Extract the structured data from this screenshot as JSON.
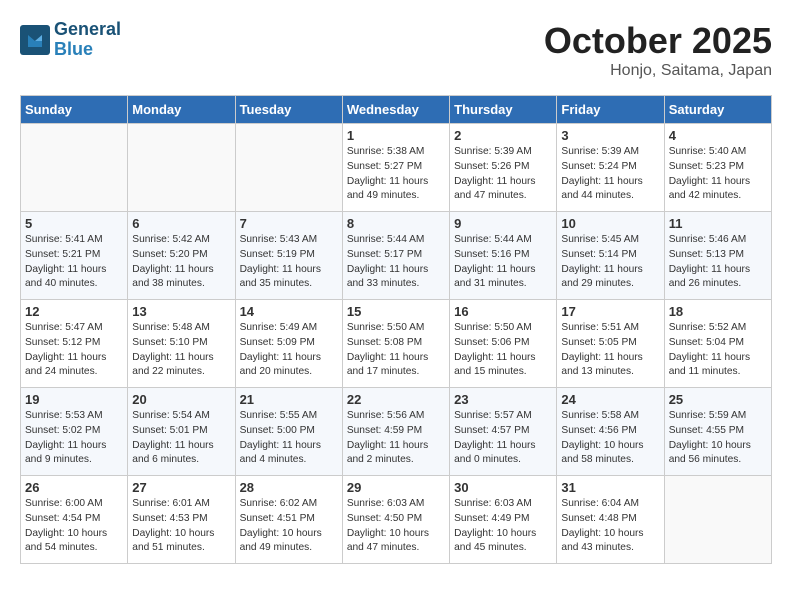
{
  "header": {
    "logo_line1": "General",
    "logo_line2": "Blue",
    "month": "October 2025",
    "location": "Honjo, Saitama, Japan"
  },
  "weekdays": [
    "Sunday",
    "Monday",
    "Tuesday",
    "Wednesday",
    "Thursday",
    "Friday",
    "Saturday"
  ],
  "weeks": [
    [
      {
        "day": "",
        "info": ""
      },
      {
        "day": "",
        "info": ""
      },
      {
        "day": "",
        "info": ""
      },
      {
        "day": "1",
        "info": "Sunrise: 5:38 AM\nSunset: 5:27 PM\nDaylight: 11 hours\nand 49 minutes."
      },
      {
        "day": "2",
        "info": "Sunrise: 5:39 AM\nSunset: 5:26 PM\nDaylight: 11 hours\nand 47 minutes."
      },
      {
        "day": "3",
        "info": "Sunrise: 5:39 AM\nSunset: 5:24 PM\nDaylight: 11 hours\nand 44 minutes."
      },
      {
        "day": "4",
        "info": "Sunrise: 5:40 AM\nSunset: 5:23 PM\nDaylight: 11 hours\nand 42 minutes."
      }
    ],
    [
      {
        "day": "5",
        "info": "Sunrise: 5:41 AM\nSunset: 5:21 PM\nDaylight: 11 hours\nand 40 minutes."
      },
      {
        "day": "6",
        "info": "Sunrise: 5:42 AM\nSunset: 5:20 PM\nDaylight: 11 hours\nand 38 minutes."
      },
      {
        "day": "7",
        "info": "Sunrise: 5:43 AM\nSunset: 5:19 PM\nDaylight: 11 hours\nand 35 minutes."
      },
      {
        "day": "8",
        "info": "Sunrise: 5:44 AM\nSunset: 5:17 PM\nDaylight: 11 hours\nand 33 minutes."
      },
      {
        "day": "9",
        "info": "Sunrise: 5:44 AM\nSunset: 5:16 PM\nDaylight: 11 hours\nand 31 minutes."
      },
      {
        "day": "10",
        "info": "Sunrise: 5:45 AM\nSunset: 5:14 PM\nDaylight: 11 hours\nand 29 minutes."
      },
      {
        "day": "11",
        "info": "Sunrise: 5:46 AM\nSunset: 5:13 PM\nDaylight: 11 hours\nand 26 minutes."
      }
    ],
    [
      {
        "day": "12",
        "info": "Sunrise: 5:47 AM\nSunset: 5:12 PM\nDaylight: 11 hours\nand 24 minutes."
      },
      {
        "day": "13",
        "info": "Sunrise: 5:48 AM\nSunset: 5:10 PM\nDaylight: 11 hours\nand 22 minutes."
      },
      {
        "day": "14",
        "info": "Sunrise: 5:49 AM\nSunset: 5:09 PM\nDaylight: 11 hours\nand 20 minutes."
      },
      {
        "day": "15",
        "info": "Sunrise: 5:50 AM\nSunset: 5:08 PM\nDaylight: 11 hours\nand 17 minutes."
      },
      {
        "day": "16",
        "info": "Sunrise: 5:50 AM\nSunset: 5:06 PM\nDaylight: 11 hours\nand 15 minutes."
      },
      {
        "day": "17",
        "info": "Sunrise: 5:51 AM\nSunset: 5:05 PM\nDaylight: 11 hours\nand 13 minutes."
      },
      {
        "day": "18",
        "info": "Sunrise: 5:52 AM\nSunset: 5:04 PM\nDaylight: 11 hours\nand 11 minutes."
      }
    ],
    [
      {
        "day": "19",
        "info": "Sunrise: 5:53 AM\nSunset: 5:02 PM\nDaylight: 11 hours\nand 9 minutes."
      },
      {
        "day": "20",
        "info": "Sunrise: 5:54 AM\nSunset: 5:01 PM\nDaylight: 11 hours\nand 6 minutes."
      },
      {
        "day": "21",
        "info": "Sunrise: 5:55 AM\nSunset: 5:00 PM\nDaylight: 11 hours\nand 4 minutes."
      },
      {
        "day": "22",
        "info": "Sunrise: 5:56 AM\nSunset: 4:59 PM\nDaylight: 11 hours\nand 2 minutes."
      },
      {
        "day": "23",
        "info": "Sunrise: 5:57 AM\nSunset: 4:57 PM\nDaylight: 11 hours\nand 0 minutes."
      },
      {
        "day": "24",
        "info": "Sunrise: 5:58 AM\nSunset: 4:56 PM\nDaylight: 10 hours\nand 58 minutes."
      },
      {
        "day": "25",
        "info": "Sunrise: 5:59 AM\nSunset: 4:55 PM\nDaylight: 10 hours\nand 56 minutes."
      }
    ],
    [
      {
        "day": "26",
        "info": "Sunrise: 6:00 AM\nSunset: 4:54 PM\nDaylight: 10 hours\nand 54 minutes."
      },
      {
        "day": "27",
        "info": "Sunrise: 6:01 AM\nSunset: 4:53 PM\nDaylight: 10 hours\nand 51 minutes."
      },
      {
        "day": "28",
        "info": "Sunrise: 6:02 AM\nSunset: 4:51 PM\nDaylight: 10 hours\nand 49 minutes."
      },
      {
        "day": "29",
        "info": "Sunrise: 6:03 AM\nSunset: 4:50 PM\nDaylight: 10 hours\nand 47 minutes."
      },
      {
        "day": "30",
        "info": "Sunrise: 6:03 AM\nSunset: 4:49 PM\nDaylight: 10 hours\nand 45 minutes."
      },
      {
        "day": "31",
        "info": "Sunrise: 6:04 AM\nSunset: 4:48 PM\nDaylight: 10 hours\nand 43 minutes."
      },
      {
        "day": "",
        "info": ""
      }
    ]
  ]
}
